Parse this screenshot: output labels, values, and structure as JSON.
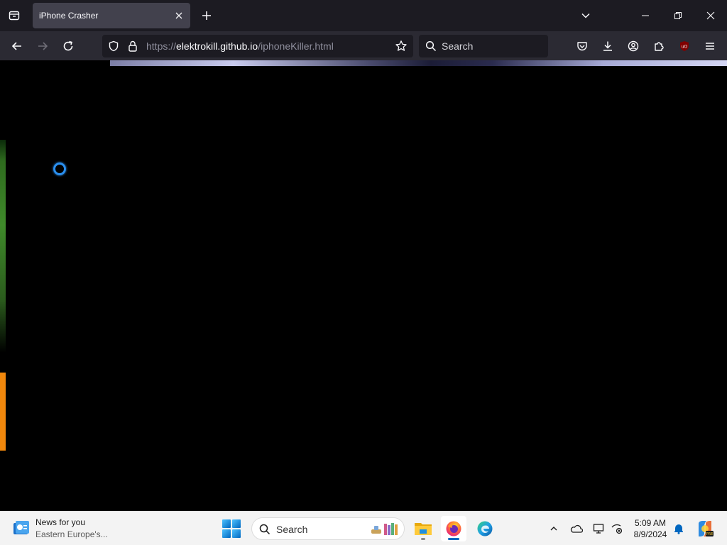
{
  "browser": {
    "tab": {
      "title": "iPhone Crasher"
    },
    "address": {
      "scheme": "https://",
      "host": "elektrokill.github.io",
      "path": "/iphoneKiller.html"
    },
    "search": {
      "placeholder": "Search"
    },
    "toolbar_icons": [
      "back-icon",
      "forward-icon",
      "reload-icon",
      "shield-icon",
      "lock-icon",
      "star-icon",
      "search-icon",
      "pocket-icon",
      "download-icon",
      "account-icon",
      "extensions-icon",
      "ublock-icon",
      "menu-icon"
    ]
  },
  "page": {
    "state": "loading",
    "accent_colors": {
      "loader": "#2a8ff0",
      "green_strip": "#3f8a2a",
      "orange_strip": "#f0870c"
    }
  },
  "taskbar": {
    "news": {
      "title": "News for you",
      "subtitle": "Eastern Europe's..."
    },
    "search": {
      "placeholder": "Search"
    },
    "apps": [
      "start-icon",
      "file-explorer-icon",
      "firefox-icon",
      "edge-icon"
    ],
    "tray_icons": [
      "chevron-up-icon",
      "onedrive-icon",
      "display-icon",
      "network-off-icon",
      "notification-bell-icon",
      "copilot-icon"
    ],
    "clock": {
      "time": "5:09 AM",
      "date": "8/9/2024"
    }
  }
}
